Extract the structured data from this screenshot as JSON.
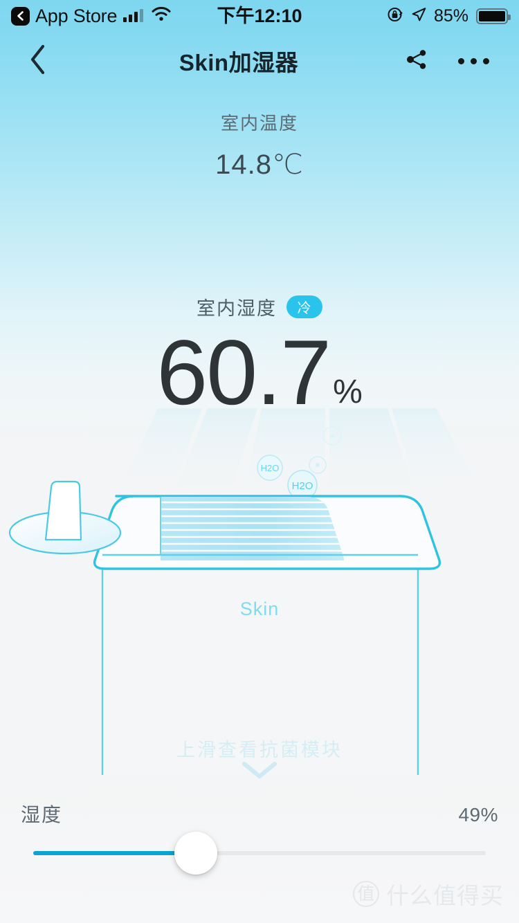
{
  "status_bar": {
    "back_app_label": "App Store",
    "back_icon": "chevron-left-filled-icon",
    "signal_icon": "cellular-signal-icon",
    "signal_bars_filled": 3,
    "signal_bars_total": 4,
    "wifi_icon": "wifi-icon",
    "time": "下午12:10",
    "rotation_lock_icon": "rotation-lock-icon",
    "location_icon": "location-arrow-icon",
    "battery_percent": "85%",
    "battery_icon": "battery-full-icon"
  },
  "nav_bar": {
    "back_icon": "chevron-left-icon",
    "title": "Skin加湿器",
    "share_icon": "share-icon",
    "more_icon": "more-dots-icon"
  },
  "readings": {
    "temperature_label": "室内温度",
    "temperature_value": "14.8℃",
    "humidity_label": "室内湿度",
    "humidity_badge": "冷",
    "humidity_value": "60.7",
    "humidity_unit": "%"
  },
  "device": {
    "brand_mark": "Skin",
    "mist_bubbles": [
      "H2O",
      "H2O"
    ],
    "swipe_hint": "上滑查看抗菌模块",
    "swipe_chevron_icon": "chevron-down-icon"
  },
  "slider": {
    "label": "湿度",
    "value_label": "49%",
    "value": 49,
    "min": 0,
    "max": 100,
    "handle_icon": "slider-thumb-icon"
  },
  "watermark": {
    "logo_char": "值",
    "text": "什么值得买"
  },
  "colors": {
    "accent_cyan": "#2ac3ec",
    "slider_fill": "#0aa3d2",
    "sky_top": "#7ed6ef",
    "page_bottom": "#f4f5f6",
    "reading_text": "#2f3437"
  }
}
